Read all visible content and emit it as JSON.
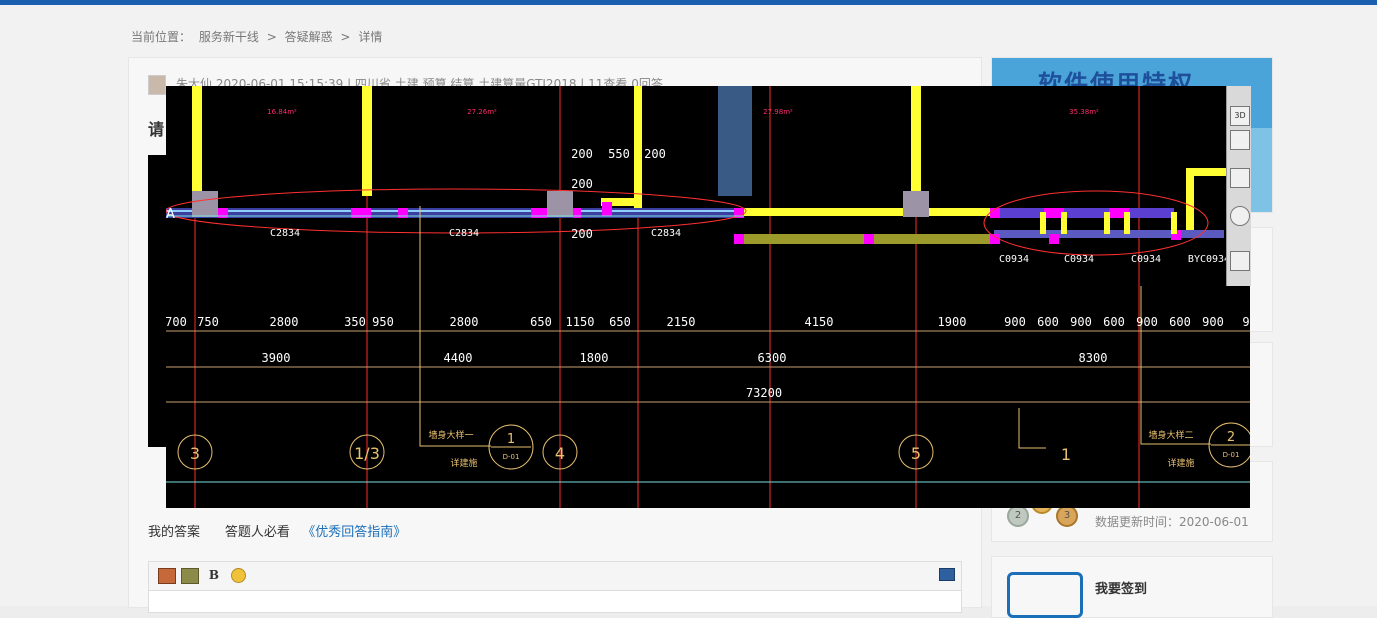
{
  "breadcrumb": {
    "prefix": "当前位置：",
    "items": [
      "服务新干线",
      "答疑解惑",
      "详情"
    ],
    "separator": ">"
  },
  "question": {
    "author_line": "朱大仙    2020-06-01 15:15:39    |    四川省  土建 预算 结算 土建算量GTJ2018    |    11查看  0回答",
    "title_fragment": "请"
  },
  "sidebar": {
    "banner_text": "软件使用特权",
    "updated_text": "数据更新时间：2020-06-01",
    "checkin_label": "我要签到"
  },
  "answer": {
    "my_answer": "我的答案",
    "must_read": "答题人必看",
    "guide_link": "《优秀回答指南》"
  },
  "editor_toolbar": {
    "icons": [
      "image-icon",
      "gallery-icon",
      "bold-icon",
      "emoji-icon",
      "screenshot-icon"
    ],
    "bold_label": "B"
  },
  "cad": {
    "axis_labels": [
      "A"
    ],
    "grid_labels": [
      "3",
      "1/3",
      "4",
      "5",
      "1"
    ],
    "detail_bubbles": [
      {
        "number": "1",
        "sheet": "D-01",
        "caption_1": "墙身大样一",
        "caption_2": "详建施"
      },
      {
        "number": "2",
        "sheet": "D-01",
        "caption_1": "墙身大样二",
        "caption_2": "详建施"
      }
    ],
    "windows": [
      "C2834",
      "C2834",
      "C2834",
      "C0934",
      "C0934",
      "C0934",
      "BYC0934"
    ],
    "top_dims": [
      "200",
      "550",
      "200",
      "200",
      "200"
    ],
    "row1_dims": [
      "700",
      "750",
      "2800",
      "350",
      "950",
      "2800",
      "650",
      "1150",
      "650",
      "2150",
      "4150",
      "1900",
      "900",
      "600",
      "900",
      "600",
      "900",
      "600",
      "900",
      "9"
    ],
    "row2_dims": [
      "3900",
      "4400",
      "1800",
      "6300",
      "8300"
    ],
    "total_dim": "73200",
    "room_areas": [
      "16.84m²",
      "27.26m²",
      "27.98m²",
      "35.38m²"
    ],
    "corner_label": "1"
  },
  "nav_cube": {
    "buttons": [
      "3D"
    ]
  },
  "colors": {
    "topbar": "#1b5fb0",
    "wall_yellow": "#ffff33",
    "column_grey": "#9c94a6",
    "magenta": "#ff00ff",
    "grid_red": "#ff2a2a",
    "dim_line": "#c8a070",
    "link_blue": "#1b6fb8"
  }
}
